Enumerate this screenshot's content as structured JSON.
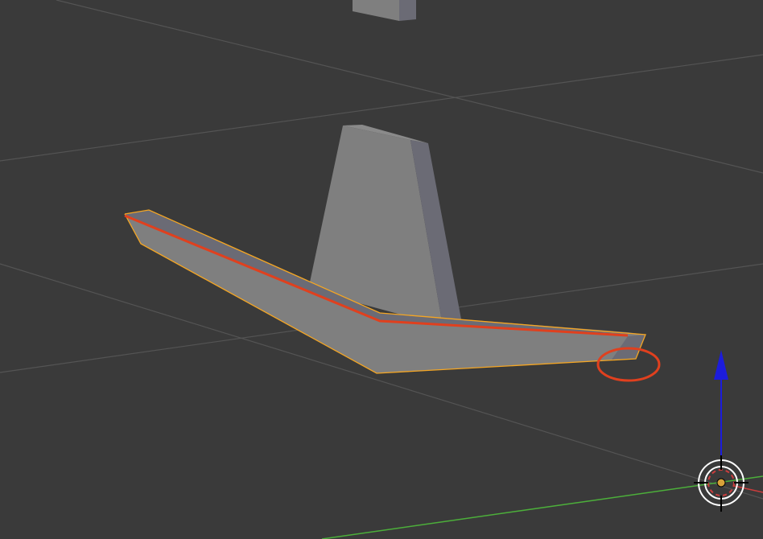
{
  "viewport": {
    "background_color": "#3a3a3a",
    "grid_color": "#545454",
    "x_axis_color": "#cc3c3c",
    "y_axis_color": "#4caf3a",
    "z_axis_color": "#1c1cdc"
  },
  "mesh": {
    "face_color": "#7f7f7f",
    "side_color": "#6b6b75",
    "selection_outline_color": "#f5a623",
    "annotation_color": "#e0401e"
  },
  "gizmo": {
    "icons": [
      "3d-cursor-icon",
      "z-axis-arrow-icon"
    ]
  }
}
